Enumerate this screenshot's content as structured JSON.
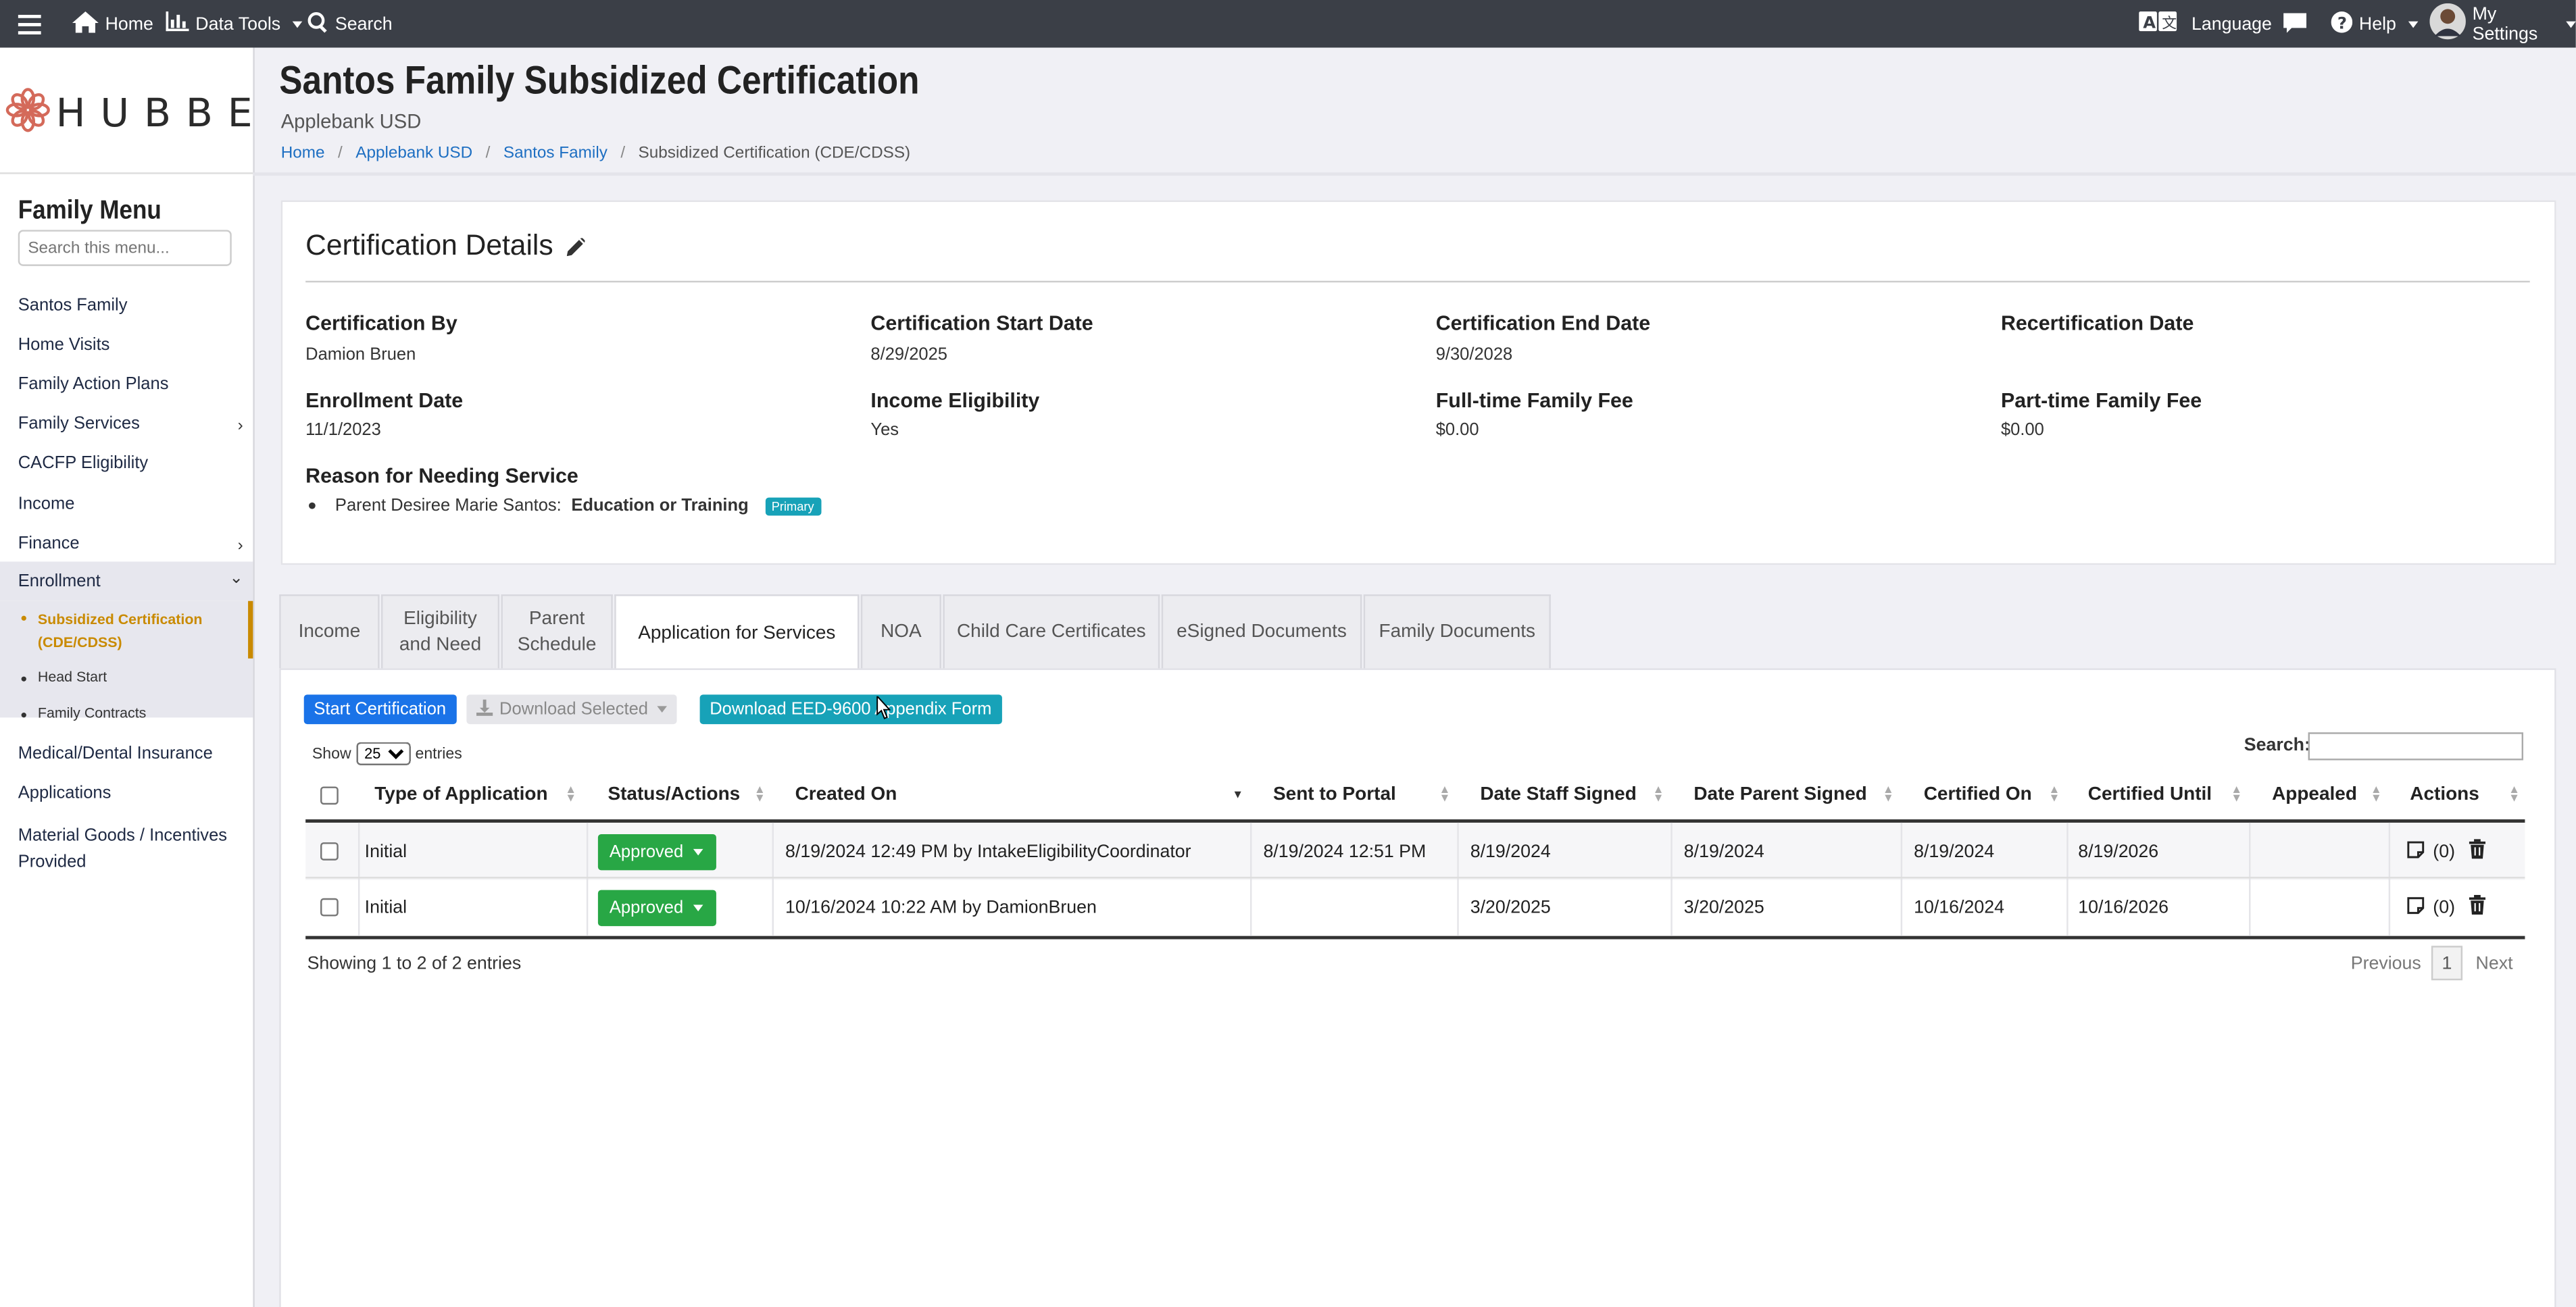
{
  "topbar": {
    "home": "Home",
    "data_tools": "Data Tools",
    "search": "Search",
    "language": "Language",
    "help": "Help",
    "settings": "My Settings"
  },
  "sidebar": {
    "logo": "HUBBE",
    "title": "Family Menu",
    "search_placeholder": "Search this menu...",
    "items": [
      "Santos Family",
      "Home Visits",
      "Family Action Plans",
      "Family Services",
      "CACFP Eligibility",
      "Income",
      "Finance",
      "Enrollment"
    ],
    "sub_items": [
      "Subsidized Certification (CDE/CDSS)",
      "Head Start",
      "Family Contracts"
    ],
    "sub_active_line1": "Subsidized Certification",
    "sub_active_line2": "(CDE/CDSS)",
    "items_after": [
      "Medical/Dental Insurance",
      "Applications",
      "Material Goods / Incentives",
      "Provided"
    ]
  },
  "header": {
    "title": "Santos Family Subsidized Certification",
    "subtitle": "Applebank USD",
    "breadcrumb": [
      "Home",
      "Applebank USD",
      "Santos Family",
      "Subsidized Certification (CDE/CDSS)"
    ]
  },
  "certification": {
    "title": "Certification Details",
    "fields": [
      {
        "label": "Certification By",
        "value": "Damion Bruen"
      },
      {
        "label": "Certification Start Date",
        "value": "8/29/2025"
      },
      {
        "label": "Certification End Date",
        "value": "9/30/2028"
      },
      {
        "label": "Recertification Date",
        "value": ""
      },
      {
        "label": "Enrollment Date",
        "value": "11/1/2023"
      },
      {
        "label": "Income Eligibility",
        "value": "Yes"
      },
      {
        "label": "Full-time Family Fee",
        "value": "$0.00"
      },
      {
        "label": "Part-time Family Fee",
        "value": "$0.00"
      }
    ],
    "reason_label": "Reason for Needing Service",
    "reason_parent": "Parent Desiree Marie Santos:",
    "reason_value": "Education or Training",
    "reason_badge": "Primary"
  },
  "tabs": [
    {
      "label1": "Income",
      "label2": ""
    },
    {
      "label1": "Eligibility",
      "label2": "and Need"
    },
    {
      "label1": "Parent",
      "label2": "Schedule"
    },
    {
      "label1": "Application for Services",
      "label2": ""
    },
    {
      "label1": "NOA",
      "label2": ""
    },
    {
      "label1": "Child Care Certificates",
      "label2": ""
    },
    {
      "label1": "eSigned Documents",
      "label2": ""
    },
    {
      "label1": "Family Documents",
      "label2": ""
    }
  ],
  "toolbar": {
    "start": "Start Certification",
    "download_selected": "Download Selected",
    "download_form": "Download EED-9600 Appendix Form"
  },
  "table": {
    "show": "Show",
    "page_size": "25",
    "entries": "entries",
    "search_label": "Search:",
    "columns": [
      "Type of Application",
      "Status/Actions",
      "Created On",
      "Sent to Portal",
      "Date Staff Signed",
      "Date Parent Signed",
      "Certified On",
      "Certified Until",
      "Appealed",
      "Actions"
    ],
    "rows": [
      {
        "type": "Initial",
        "status": "Approved",
        "created": "8/19/2024 12:49 PM by IntakeEligibilityCoordinator",
        "sent": "8/19/2024 12:51 PM",
        "staff": "8/19/2024",
        "parent": "8/19/2024",
        "certified_on": "8/19/2024",
        "certified_until": "8/19/2026",
        "appealed": "",
        "notes": "(0)"
      },
      {
        "type": "Initial",
        "status": "Approved",
        "created": "10/16/2024 10:22 AM by DamionBruen",
        "sent": "",
        "staff": "3/20/2025",
        "parent": "3/20/2025",
        "certified_on": "10/16/2024",
        "certified_until": "10/16/2026",
        "appealed": "",
        "notes": "(0)"
      }
    ],
    "info": "Showing 1 to 2 of 2 entries",
    "prev": "Previous",
    "page": "1",
    "next": "Next"
  }
}
